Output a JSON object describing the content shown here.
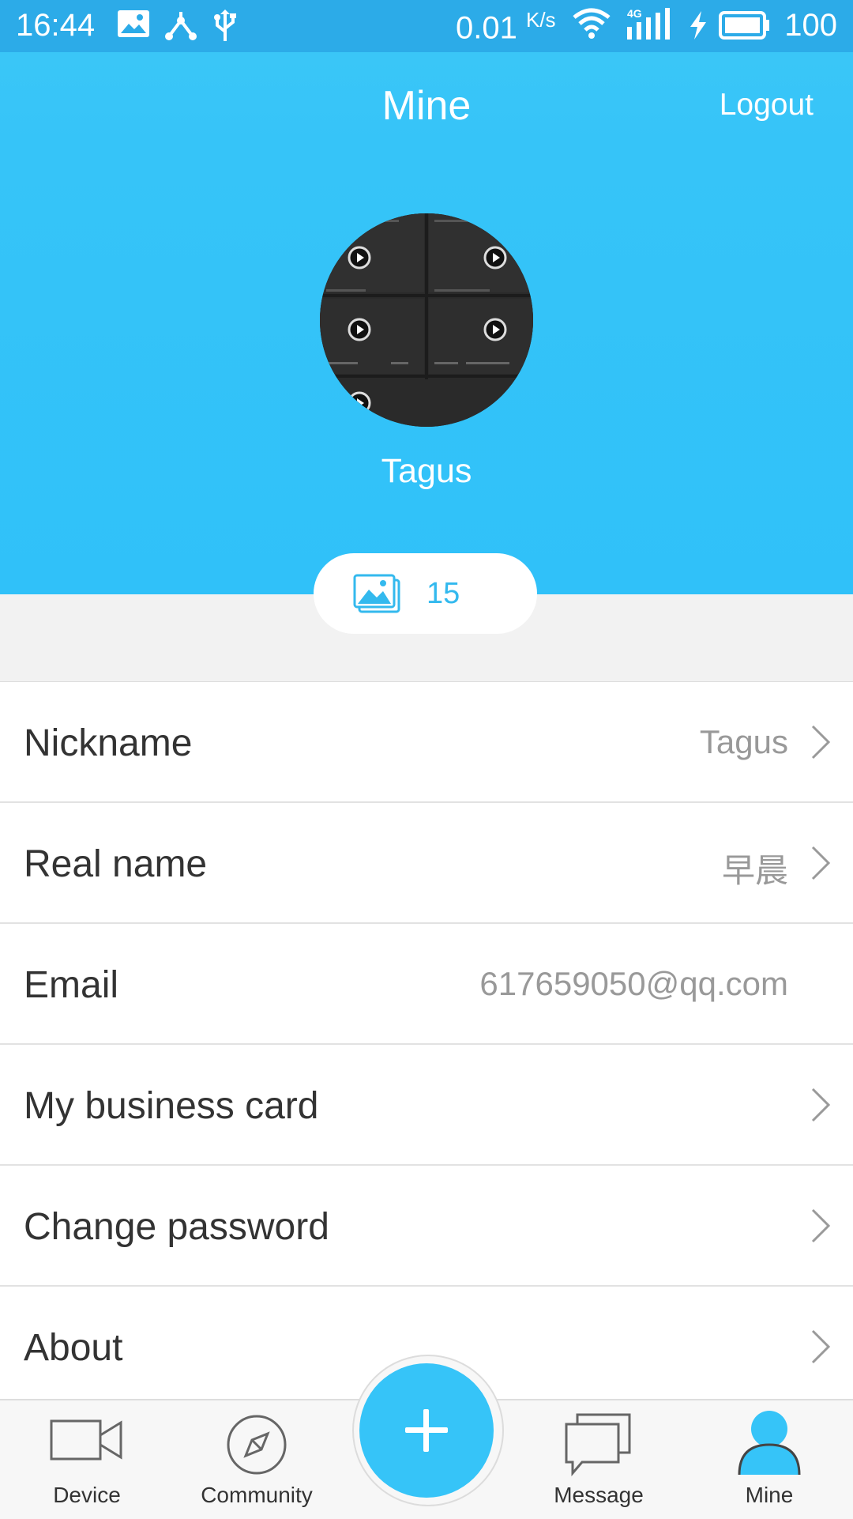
{
  "status_bar": {
    "time": "16:44",
    "speed": "0.01",
    "speed_unit": "K/s",
    "network": "4G",
    "battery": "100",
    "icons": [
      "image-notification-icon",
      "share-network-icon",
      "usb-icon",
      "wifi-icon",
      "signal-icon",
      "charging-icon",
      "battery-icon"
    ]
  },
  "header": {
    "title": "Mine",
    "logout_label": "Logout",
    "username": "Tagus",
    "accent_color": "#36c4f8"
  },
  "album": {
    "icon": "gallery-icon",
    "count": "15"
  },
  "settings": [
    {
      "label": "Nickname",
      "value": "Tagus",
      "chevron": true
    },
    {
      "label": "Real name",
      "value": "早晨",
      "chevron": true
    },
    {
      "label": "Email",
      "value": "617659050@qq.com",
      "chevron": false
    },
    {
      "label": "My business card",
      "value": "",
      "chevron": true
    },
    {
      "label": "Change password",
      "value": "",
      "chevron": true
    },
    {
      "label": "About",
      "value": "",
      "chevron": true
    }
  ],
  "bottom_nav": {
    "items": [
      {
        "label": "Device",
        "icon": "video-camera-icon"
      },
      {
        "label": "Community",
        "icon": "compass-icon"
      },
      {
        "label": "Message",
        "icon": "chat-bubbles-icon"
      },
      {
        "label": "Mine",
        "icon": "person-icon",
        "active": true
      }
    ],
    "fab_icon": "plus-icon"
  }
}
